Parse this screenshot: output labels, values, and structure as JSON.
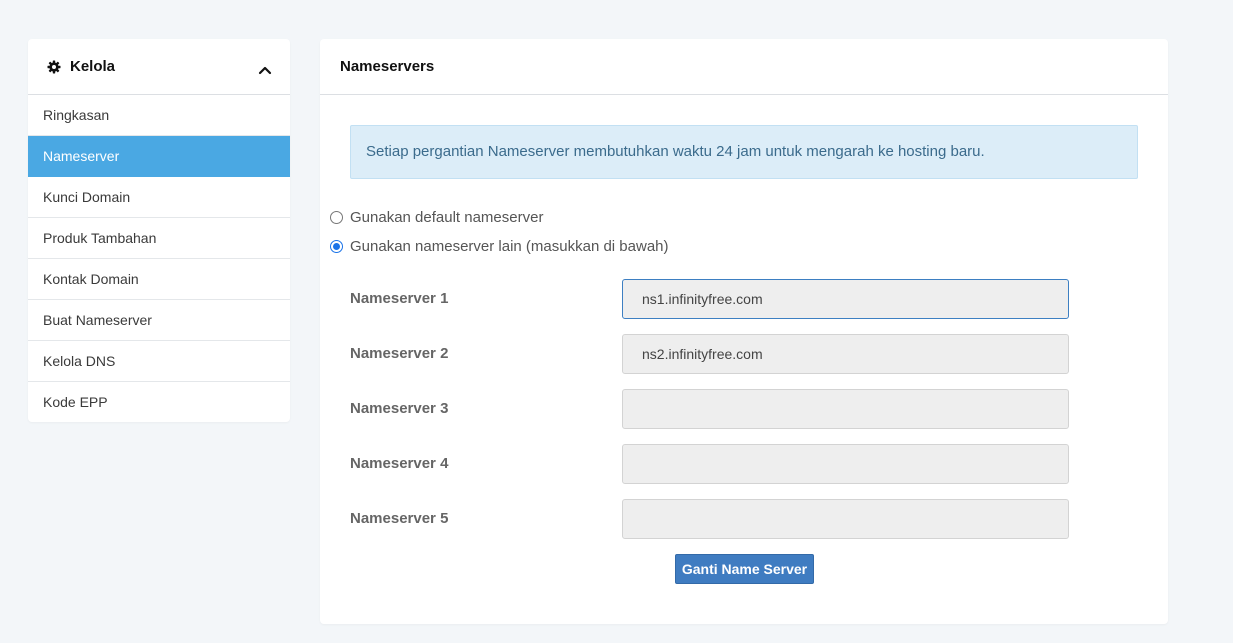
{
  "sidebar": {
    "title": "Kelola",
    "items": [
      {
        "label": "Ringkasan"
      },
      {
        "label": "Nameserver"
      },
      {
        "label": "Kunci Domain"
      },
      {
        "label": "Produk Tambahan"
      },
      {
        "label": "Kontak Domain"
      },
      {
        "label": "Buat Nameserver"
      },
      {
        "label": "Kelola DNS"
      },
      {
        "label": "Kode EPP"
      }
    ],
    "active_index": 1
  },
  "main": {
    "title": "Nameservers",
    "alert_text": "Setiap pergantian Nameserver membutuhkan waktu 24 jam untuk mengarah ke hosting baru.",
    "options": [
      {
        "label": "Gunakan default nameserver",
        "checked": false
      },
      {
        "label": "Gunakan nameserver lain (masukkan di bawah)",
        "checked": true
      }
    ],
    "nameservers": [
      {
        "label": "Nameserver 1",
        "value": "ns1.infinityfree.com"
      },
      {
        "label": "Nameserver 2",
        "value": "ns2.infinityfree.com"
      },
      {
        "label": "Nameserver 3",
        "value": ""
      },
      {
        "label": "Nameserver 4",
        "value": ""
      },
      {
        "label": "Nameserver 5",
        "value": ""
      }
    ],
    "submit_label": "Ganti Name Server"
  },
  "colors": {
    "page_bg": "#f3f6f9",
    "active_item": "#4aa8e3",
    "alert_bg": "#dcedf8",
    "button": "#3f7cc1"
  }
}
